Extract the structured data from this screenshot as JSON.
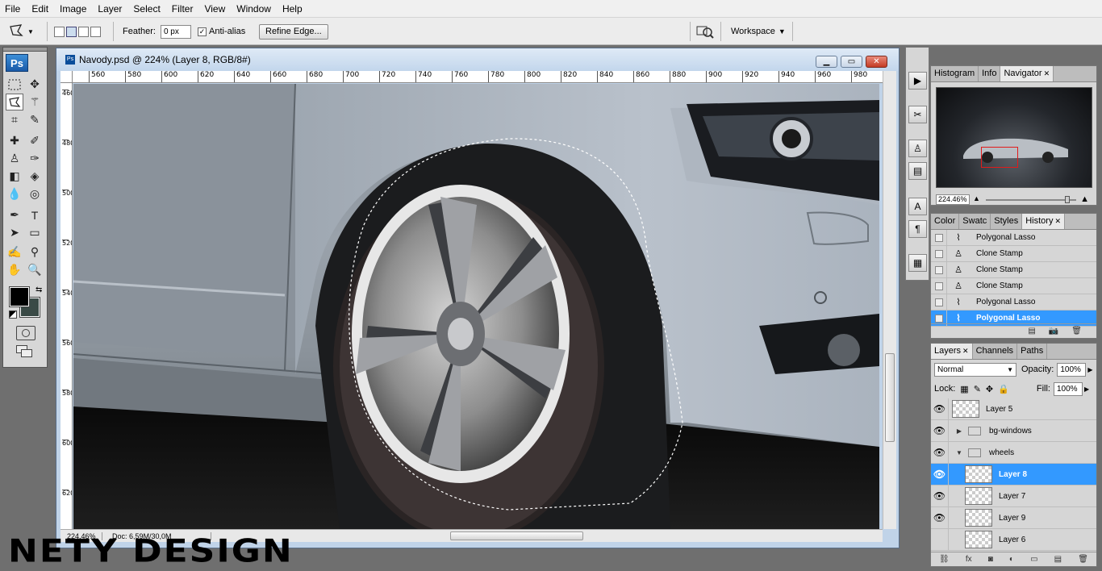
{
  "menubar": [
    "File",
    "Edit",
    "Image",
    "Layer",
    "Select",
    "Filter",
    "View",
    "Window",
    "Help"
  ],
  "options": {
    "feather_label": "Feather:",
    "feather_value": "0 px",
    "antialias_label": "Anti-alias",
    "antialias_checked": true,
    "refine_edge": "Refine Edge...",
    "workspace": "Workspace"
  },
  "tools": {
    "logo": "Ps",
    "foreground_color": "#000000",
    "background_color": "#3a4a46"
  },
  "document": {
    "title": "Navody.psd @ 224% (Layer 8, RGB/8#)",
    "zoom": "224,46%",
    "doc_info": "Doc: 6,59M/30,0M",
    "ruler_h": [
      "560",
      "580",
      "600",
      "620",
      "640",
      "660",
      "680",
      "700",
      "720",
      "740",
      "760",
      "780",
      "800",
      "820",
      "840",
      "860",
      "880",
      "900",
      "920",
      "940",
      "960",
      "980"
    ],
    "ruler_v": [
      "460",
      "480",
      "500",
      "520",
      "540",
      "560",
      "580",
      "600",
      "620"
    ]
  },
  "navigator": {
    "tabs": [
      "Histogram",
      "Info",
      "Navigator"
    ],
    "active_tab": "Navigator",
    "zoom": "224.46%"
  },
  "history": {
    "tabs": [
      "Color",
      "Swatc",
      "Styles",
      "History"
    ],
    "active_tab": "History",
    "items": [
      {
        "name": "Polygonal Lasso",
        "icon": "lasso-icon",
        "selected": false
      },
      {
        "name": "Clone Stamp",
        "icon": "stamp-icon",
        "selected": false
      },
      {
        "name": "Clone Stamp",
        "icon": "stamp-icon",
        "selected": false
      },
      {
        "name": "Clone Stamp",
        "icon": "stamp-icon",
        "selected": false
      },
      {
        "name": "Polygonal Lasso",
        "icon": "lasso-icon",
        "selected": false
      },
      {
        "name": "Polygonal Lasso",
        "icon": "lasso-icon",
        "selected": true
      }
    ]
  },
  "layers": {
    "tabs": [
      "Layers",
      "Channels",
      "Paths"
    ],
    "active_tab": "Layers",
    "blend_mode": "Normal",
    "opacity_label": "Opacity:",
    "opacity": "100%",
    "lock_label": "Lock:",
    "fill_label": "Fill:",
    "fill": "100%",
    "rows": [
      {
        "name": "Layer 5",
        "type": "layer",
        "visible": true,
        "selected": false
      },
      {
        "name": "bg-windows",
        "type": "group",
        "expanded": false,
        "visible": true,
        "selected": false
      },
      {
        "name": "wheels",
        "type": "group",
        "expanded": true,
        "visible": true,
        "selected": false
      },
      {
        "name": "Layer 8",
        "type": "layer",
        "visible": true,
        "selected": true
      },
      {
        "name": "Layer 7",
        "type": "layer",
        "visible": true,
        "selected": false
      },
      {
        "name": "Layer 9",
        "type": "layer",
        "visible": true,
        "selected": false
      },
      {
        "name": "Layer 6",
        "type": "layer",
        "visible": false,
        "selected": false
      }
    ]
  },
  "watermark": "NETY DESIGN"
}
